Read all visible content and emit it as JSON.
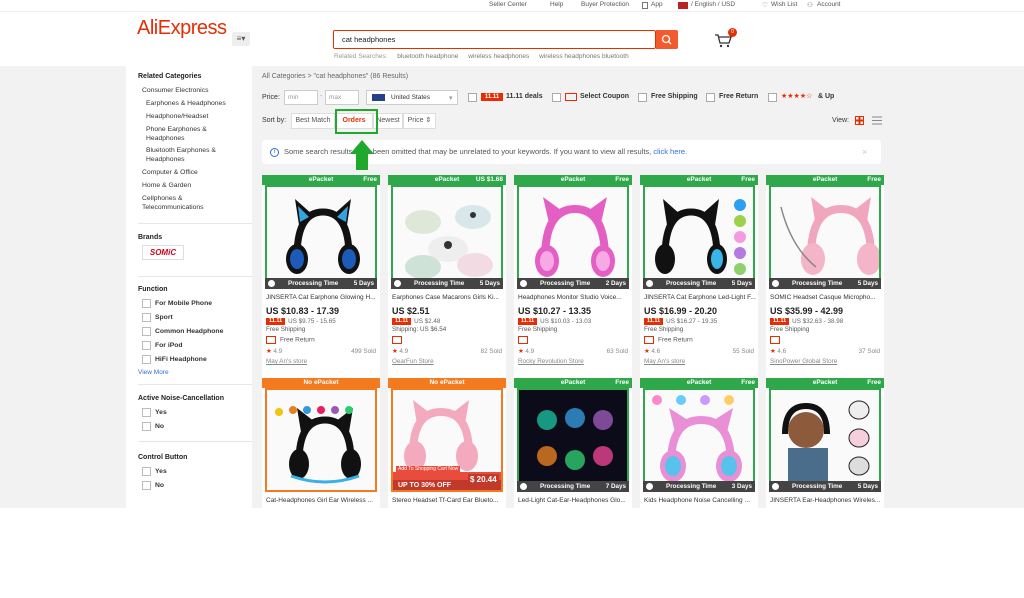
{
  "topbar": {
    "seller_center": "Seller Center",
    "help": "Help",
    "buyer_protection": "Buyer Protection",
    "app": "App",
    "language": "/ English / USD",
    "wish_list": "Wish List",
    "account": "Account"
  },
  "header": {
    "logo": "AliExpress",
    "search_value": "cat headphones",
    "related_label": "Related Searches:",
    "related": [
      "bluetooth headphone",
      "wireless headphones",
      "wireless headphones bluetooth"
    ],
    "cart_count": "0"
  },
  "sidebar": {
    "related_categories_title": "Related Categories",
    "categories": [
      "Consumer Electronics",
      "Earphones & Headphones",
      "Headphone/Headset",
      "Phone Earphones & Headphones",
      "Bluetooth Earphones & Headphones",
      "Computer & Office",
      "Home & Garden",
      "Cellphones & Telecommunications"
    ],
    "brands_title": "Brands",
    "brand_logo": "SOMiC",
    "function_title": "Function",
    "functions": [
      "For Mobile Phone",
      "Sport",
      "Common Headphone",
      "For iPod",
      "HiFi Headphone"
    ],
    "view_more": "View More",
    "anc_title": "Active Noise-Cancellation",
    "anc_options": [
      "Yes",
      "No"
    ],
    "control_title": "Control Button",
    "control_options": [
      "Yes",
      "No"
    ]
  },
  "main": {
    "breadcrumb": "All Categories > \"cat headphones\" (86 Results)",
    "price_label": "Price:",
    "price_min": "min",
    "price_max": "max",
    "ship_to": "United States",
    "deals_tag": "11.11",
    "deals_label": "11.11 deals",
    "coupon_label": "Select Coupon",
    "free_shipping": "Free Shipping",
    "free_return": "Free Return",
    "stars_label": "★★★★☆",
    "and_up": "& Up",
    "sort_label": "Sort by:",
    "sort": [
      "Best Match",
      "Orders",
      "Newest",
      "Price ⇕"
    ],
    "view_label": "View:",
    "banner_text": "Some search results have been omitted that may be unrelated to your keywords. If you want to view all results,",
    "banner_link": "click here."
  },
  "products": [
    {
      "badge": "ePacket",
      "badge_right": "Free",
      "badge_color": "#2ea84a",
      "days": "5 Days",
      "title": "JINSERTA Cat Earphone Glowing H...",
      "price": "US $10.83 - 17.39",
      "sale": "US $9.75 - 15.65",
      "ship": "Free Shipping",
      "ret": "Free Return",
      "rating": "4.9",
      "sold": "499 Sold",
      "store": "May An's store"
    },
    {
      "badge": "ePacket",
      "badge_right": "US $1.68",
      "badge_color": "#2ea84a",
      "days": "5 Days",
      "title": "Earphones Case Macarons Girls Ki...",
      "price": "US $2.51",
      "sale": "US $2.48",
      "ship": "Shipping: US $6.54",
      "ret": "",
      "rating": "4.9",
      "sold": "82 Sold",
      "store": "OearFun Store"
    },
    {
      "badge": "ePacket",
      "badge_right": "Free",
      "badge_color": "#2ea84a",
      "days": "2 Days",
      "title": "Headphones Monitor Studio Voice...",
      "price": "US $10.27 - 13.35",
      "sale": "US $10.03 - 13.03",
      "ship": "Free Shipping",
      "ret": "",
      "rating": "4.9",
      "sold": "63 Sold",
      "store": "Rocky Revolution Store"
    },
    {
      "badge": "ePacket",
      "badge_right": "Free",
      "badge_color": "#2ea84a",
      "days": "5 Days",
      "title": "JINSERTA Cat Earphone Led-Light F...",
      "price": "US $16.99 - 20.20",
      "sale": "US $16.27 - 19.35",
      "ship": "Free Shipping",
      "ret": "Free Return",
      "rating": "4.6",
      "sold": "55 Sold",
      "store": "May An's store"
    },
    {
      "badge": "ePacket",
      "badge_right": "Free",
      "badge_color": "#2ea84a",
      "days": "5 Days",
      "title": "SOMIC Headset Casque Micropho...",
      "price": "US $35.99 - 42.99",
      "sale": "US $32.63 - 38.98",
      "ship": "Free Shipping",
      "ret": "",
      "rating": "4.6",
      "sold": "37 Sold",
      "store": "SinoPower Global Store"
    },
    {
      "badge": "No ePacket",
      "badge_right": "",
      "badge_color": "#f47a20",
      "days": "",
      "title": "Cat-Headphones Girl Ear Wireless ...",
      "price": "",
      "sale": "",
      "ship": "",
      "ret": "",
      "rating": "",
      "sold": "",
      "store": ""
    },
    {
      "badge": "No ePacket",
      "badge_right": "",
      "badge_color": "#f47a20",
      "days": "",
      "title": "Stereo Headset Tf-Card Ear Blueto...",
      "price": "",
      "sale": "",
      "ship": "",
      "ret": "",
      "rating": "",
      "sold": "",
      "store": ""
    },
    {
      "badge": "ePacket",
      "badge_right": "Free",
      "badge_color": "#2ea84a",
      "days": "7 Days",
      "title": "Led-Light Cat-Ear-Headphones Glo...",
      "price": "",
      "sale": "",
      "ship": "",
      "ret": "",
      "rating": "",
      "sold": "",
      "store": ""
    },
    {
      "badge": "ePacket",
      "badge_right": "Free",
      "badge_color": "#2ea84a",
      "days": "3 Days",
      "title": "Kids Headphone Noise Cancelling ...",
      "price": "",
      "sale": "",
      "ship": "",
      "ret": "",
      "rating": "",
      "sold": "",
      "store": ""
    },
    {
      "badge": "ePacket",
      "badge_right": "Free",
      "badge_color": "#2ea84a",
      "days": "5 Days",
      "title": "JINSERTA Ear-Headphones Wireles...",
      "price": "",
      "sale": "",
      "ship": "",
      "ret": "",
      "rating": "",
      "sold": "",
      "store": ""
    }
  ],
  "processing_label": "Processing Time",
  "promo_overlay": {
    "add_to_cart": "Add To Shopping Cart Now",
    "upto": "UP TO 30% OFF",
    "price": "$ 20.44"
  }
}
